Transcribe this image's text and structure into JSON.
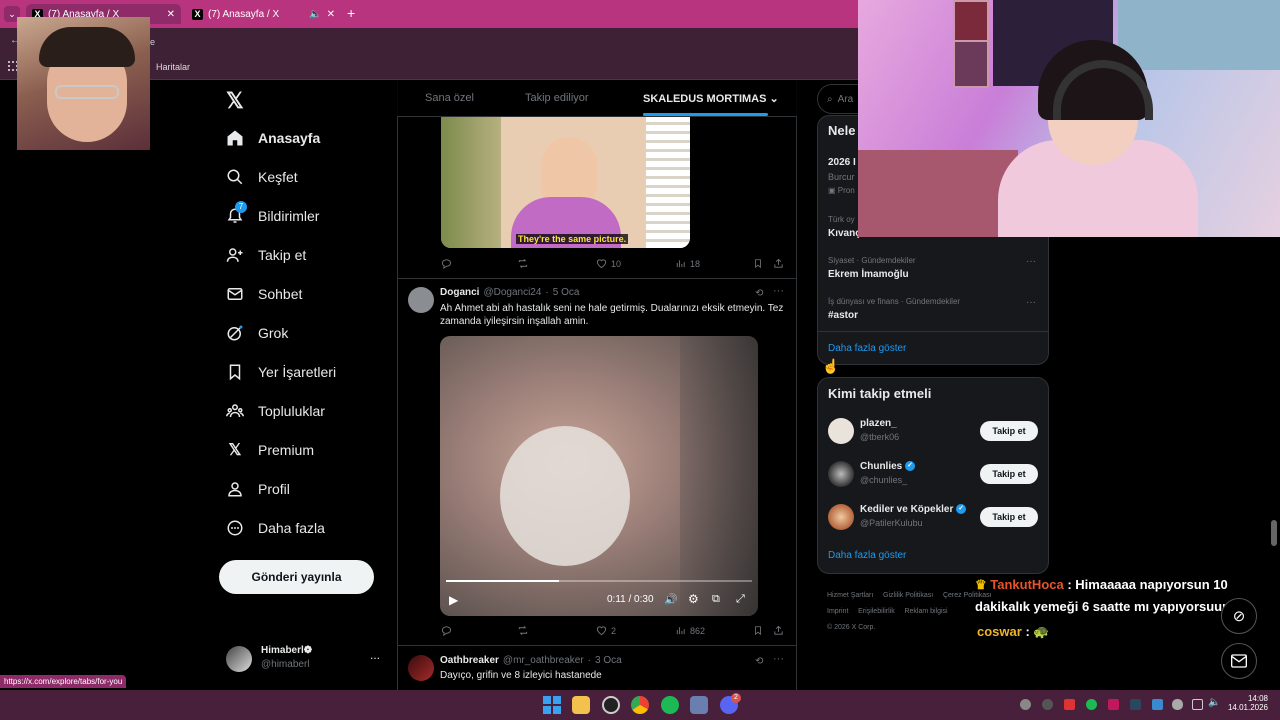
{
  "browser": {
    "tabs": [
      {
        "title": "(7) Anasayfa / X",
        "active": true
      },
      {
        "title": "(7) Anasayfa / X",
        "active": false
      }
    ],
    "new_tab_symbol": "+",
    "bookmark": "Haritalar",
    "addr_fragment": "e"
  },
  "nav": {
    "items": [
      {
        "label": "Anasayfa",
        "icon": "home-icon"
      },
      {
        "label": "Keşfet",
        "icon": "search-icon"
      },
      {
        "label": "Bildirimler",
        "icon": "bell-icon",
        "badge": "7"
      },
      {
        "label": "Takip et",
        "icon": "add-user-icon"
      },
      {
        "label": "Sohbet",
        "icon": "mail-icon"
      },
      {
        "label": "Grok",
        "icon": "grok-icon"
      },
      {
        "label": "Yer İşaretleri",
        "icon": "bookmark-icon"
      },
      {
        "label": "Topluluklar",
        "icon": "communities-icon"
      },
      {
        "label": "Premium",
        "icon": "x-icon"
      },
      {
        "label": "Profil",
        "icon": "profile-icon"
      },
      {
        "label": "Daha fazla",
        "icon": "more-circle-icon"
      }
    ],
    "post_button": "Gönderi yayınla",
    "account": {
      "name": "Himaberl❁",
      "handle": "@himaberl",
      "more": "..."
    }
  },
  "feed": {
    "tabs": [
      "Sana özel",
      "Takip ediliyor",
      "SKALEDUS MORTIMAS"
    ],
    "tweet1": {
      "caption": "They're the same picture.",
      "views": "18",
      "likes": "10"
    },
    "tweet2": {
      "name": "Doganci",
      "handle": "@Doganci24",
      "date": "5 Oca",
      "text": "Ah Ahmet abi ah hastalık seni ne hale getirmiş. Dualarınızı eksik etmeyin. Tez zamanda iyileşirsin inşallah amin.",
      "video_time": "0:11 / 0:30",
      "video_progress": 0.37,
      "likes": "2",
      "views": "862"
    },
    "tweet3": {
      "name": "Oathbreaker",
      "handle": "@mr_oathbreaker",
      "date": "3 Oca",
      "text": "Dayıço, grifin ve 8 izleyici hastanede"
    }
  },
  "right": {
    "search_placeholder": "Ara",
    "trends_title": "Nele",
    "trend_top": {
      "title": "2026 I",
      "sub": "Burcur",
      "promo": "Pron"
    },
    "trend_cut": {
      "meta": "Türk oy",
      "title": "Kıvanç"
    },
    "trends": [
      {
        "meta": "Siyaset · Gündemdekiler",
        "title": "Ekrem İmamoğlu"
      },
      {
        "meta": "İş dünyası ve finans · Gündemdekiler",
        "title": "#astor"
      }
    ],
    "show_more": "Daha fazla göster",
    "who_to_follow_title": "Kimi takip etmeli",
    "suggestions": [
      {
        "name": "plazen_",
        "handle": "@tberk06",
        "verified": false
      },
      {
        "name": "Chunlies",
        "handle": "@chunlies_",
        "verified": true
      },
      {
        "name": "Kediler ve Köpekler",
        "handle": "@PatilerKulubu",
        "verified": true
      }
    ],
    "follow_label": "Takip et",
    "footer": [
      "Hizmet Şartları",
      "Gizlilik Politikası",
      "Çerez Politikası",
      "Imprint",
      "Erişilebilirlik",
      "Reklam bilgisi",
      "© 2026 X Corp."
    ]
  },
  "chat": {
    "user1": "TankutHoca",
    "msg1": ": Himaaaaa napıyorsun 10",
    "msg1b": "dakikalık yemeği 6 saatte mı yapıyorsuun",
    "user2": "coswar",
    "msg2": ":",
    "colors": {
      "user1": "#e8542a",
      "user2": "#f0b428"
    }
  },
  "status_url": "https://x.com/explore/tabs/for-you",
  "clock": {
    "time": "14:08",
    "date": "14.01.2026"
  },
  "taskbar_badge": "2"
}
